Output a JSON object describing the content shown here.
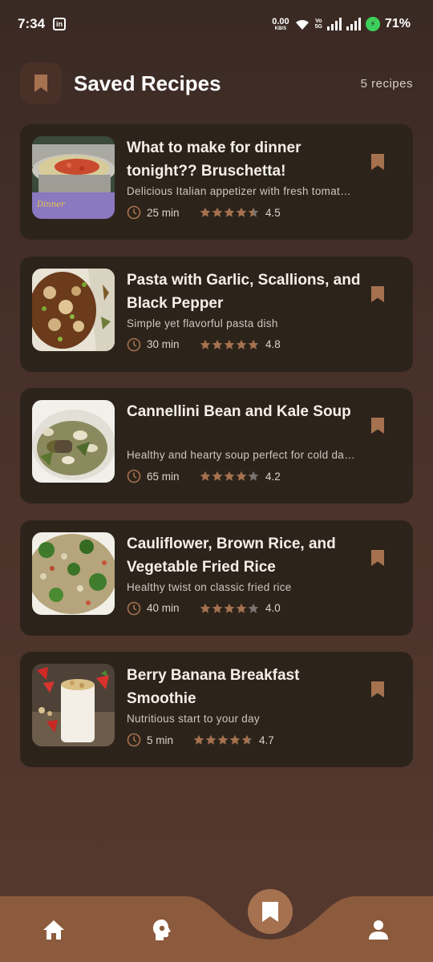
{
  "status_bar": {
    "time": "7:34",
    "notification_icon": "linkedin-icon",
    "net_speed": "0.00",
    "net_speed_unit": "KB/S",
    "volte_top": "Vo",
    "volte_mid": "LTE",
    "volte_bottom": "5G",
    "battery": "71%"
  },
  "header": {
    "icon": "bookmark-icon",
    "title": "Saved Recipes",
    "count": "5 recipes"
  },
  "colors": {
    "background_top": "#3a2a24",
    "card": "#2c241b",
    "accent": "#a6714f",
    "nav_bar": "#8c5a3c"
  },
  "recipes": [
    {
      "title": "What to make for dinner tonight?? Bruschetta!",
      "description": "Delicious Italian appetizer with fresh tomatoes and basil",
      "time": "25 min",
      "rating": "4.5",
      "stars_value": 4.5,
      "image": "bruschetta-pasta-photo"
    },
    {
      "title": "Pasta with Garlic, Scallions, and Black Pepper",
      "description": "Simple yet flavorful pasta dish",
      "time": "30 min",
      "rating": "4.8",
      "stars_value": 4.8,
      "image": "garlic-pasta-photo"
    },
    {
      "title": "Cannellini Bean and Kale Soup",
      "description": "Healthy and hearty soup perfect for cold days",
      "time": "65 min",
      "rating": "4.2",
      "stars_value": 4.2,
      "image": "bean-kale-soup-photo"
    },
    {
      "title": "Cauliflower, Brown Rice, and Vegetable Fried Rice",
      "description": "Healthy twist on classic fried rice",
      "time": "40 min",
      "rating": "4.0",
      "stars_value": 4.0,
      "image": "fried-rice-photo"
    },
    {
      "title": "Berry Banana Breakfast Smoothie",
      "description": "Nutritious start to your day",
      "time": "5 min",
      "rating": "4.7",
      "stars_value": 4.7,
      "image": "berry-smoothie-photo"
    }
  ],
  "bottom_nav": {
    "items": [
      {
        "icon": "home-icon"
      },
      {
        "icon": "explore-icon"
      },
      {
        "icon": "bookmark-icon",
        "active": true
      },
      {
        "icon": "profile-icon"
      }
    ]
  }
}
